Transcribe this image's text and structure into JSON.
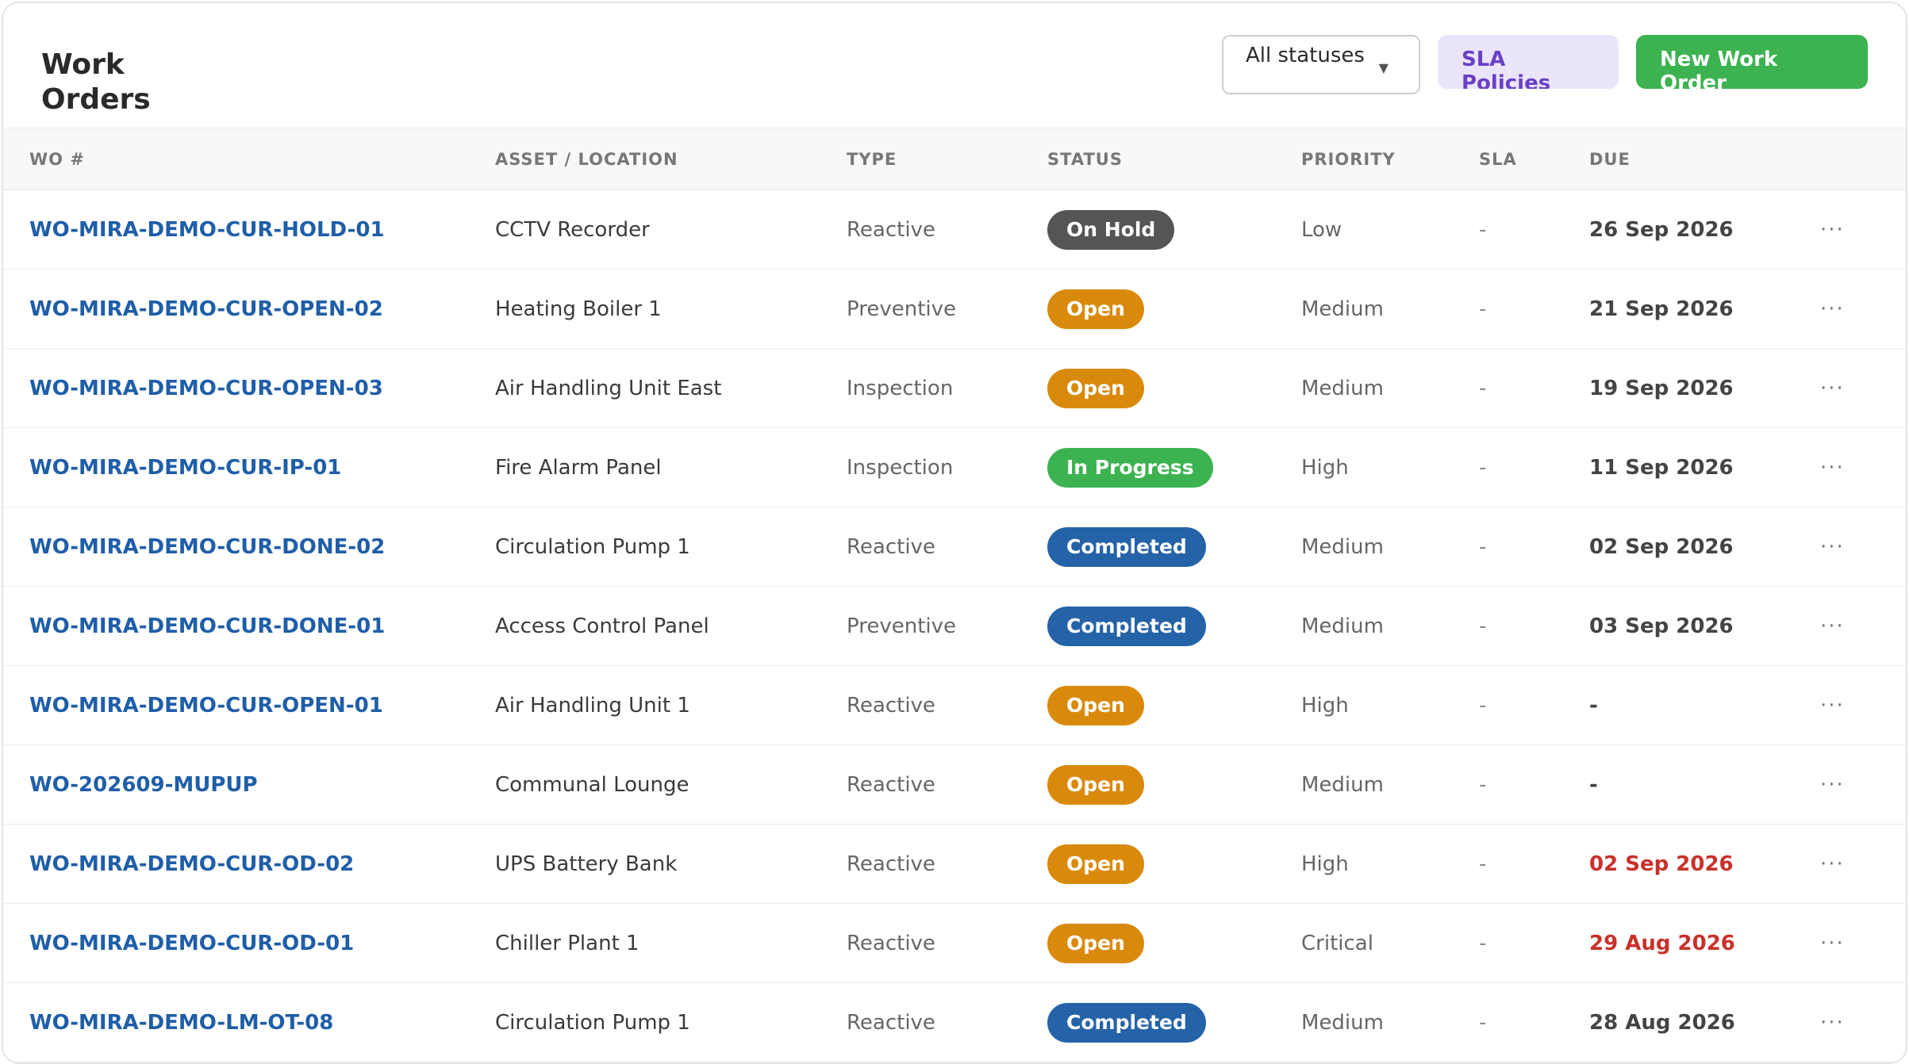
{
  "header": {
    "title": "Work Orders",
    "status_filter": "All statuses",
    "sla_button": "SLA Policies",
    "new_button": "New Work Order"
  },
  "columns": [
    "WO #",
    "ASSET / LOCATION",
    "TYPE",
    "STATUS",
    "PRIORITY",
    "SLA",
    "DUE"
  ],
  "colors": {
    "link": "#1f5ea8",
    "on_hold": "#555555",
    "open": "#d98a0b",
    "in_progress": "#3cb350",
    "completed": "#2563a8",
    "overdue": "#c8312a"
  },
  "rows": [
    {
      "wo": "WO-MIRA-DEMO-CUR-HOLD-01",
      "asset": "CCTV Recorder",
      "type": "Reactive",
      "status": "On Hold",
      "status_key": "on_hold",
      "priority": "Low",
      "sla": "-",
      "due": "26 Sep 2026",
      "overdue": false
    },
    {
      "wo": "WO-MIRA-DEMO-CUR-OPEN-02",
      "asset": "Heating Boiler 1",
      "type": "Preventive",
      "status": "Open",
      "status_key": "open",
      "priority": "Medium",
      "sla": "-",
      "due": "21 Sep 2026",
      "overdue": false
    },
    {
      "wo": "WO-MIRA-DEMO-CUR-OPEN-03",
      "asset": "Air Handling Unit East",
      "type": "Inspection",
      "status": "Open",
      "status_key": "open",
      "priority": "Medium",
      "sla": "-",
      "due": "19 Sep 2026",
      "overdue": false
    },
    {
      "wo": "WO-MIRA-DEMO-CUR-IP-01",
      "asset": "Fire Alarm Panel",
      "type": "Inspection",
      "status": "In Progress",
      "status_key": "in_progress",
      "priority": "High",
      "sla": "-",
      "due": "11 Sep 2026",
      "overdue": false
    },
    {
      "wo": "WO-MIRA-DEMO-CUR-DONE-02",
      "asset": "Circulation Pump 1",
      "type": "Reactive",
      "status": "Completed",
      "status_key": "completed",
      "priority": "Medium",
      "sla": "-",
      "due": "02 Sep 2026",
      "overdue": false
    },
    {
      "wo": "WO-MIRA-DEMO-CUR-DONE-01",
      "asset": "Access Control Panel",
      "type": "Preventive",
      "status": "Completed",
      "status_key": "completed",
      "priority": "Medium",
      "sla": "-",
      "due": "03 Sep 2026",
      "overdue": false
    },
    {
      "wo": "WO-MIRA-DEMO-CUR-OPEN-01",
      "asset": "Air Handling Unit 1",
      "type": "Reactive",
      "status": "Open",
      "status_key": "open",
      "priority": "High",
      "sla": "-",
      "due": "-",
      "overdue": false
    },
    {
      "wo": "WO-202609-MUPUP",
      "asset": "Communal Lounge",
      "type": "Reactive",
      "status": "Open",
      "status_key": "open",
      "priority": "Medium",
      "sla": "-",
      "due": "-",
      "overdue": false
    },
    {
      "wo": "WO-MIRA-DEMO-CUR-OD-02",
      "asset": "UPS Battery Bank",
      "type": "Reactive",
      "status": "Open",
      "status_key": "open",
      "priority": "High",
      "sla": "-",
      "due": "02 Sep 2026",
      "overdue": true
    },
    {
      "wo": "WO-MIRA-DEMO-CUR-OD-01",
      "asset": "Chiller Plant 1",
      "type": "Reactive",
      "status": "Open",
      "status_key": "open",
      "priority": "Critical",
      "sla": "-",
      "due": "29 Aug 2026",
      "overdue": true
    },
    {
      "wo": "WO-MIRA-DEMO-LM-OT-08",
      "asset": "Circulation Pump 1",
      "type": "Reactive",
      "status": "Completed",
      "status_key": "completed",
      "priority": "Medium",
      "sla": "-",
      "due": "28 Aug 2026",
      "overdue": false
    }
  ]
}
